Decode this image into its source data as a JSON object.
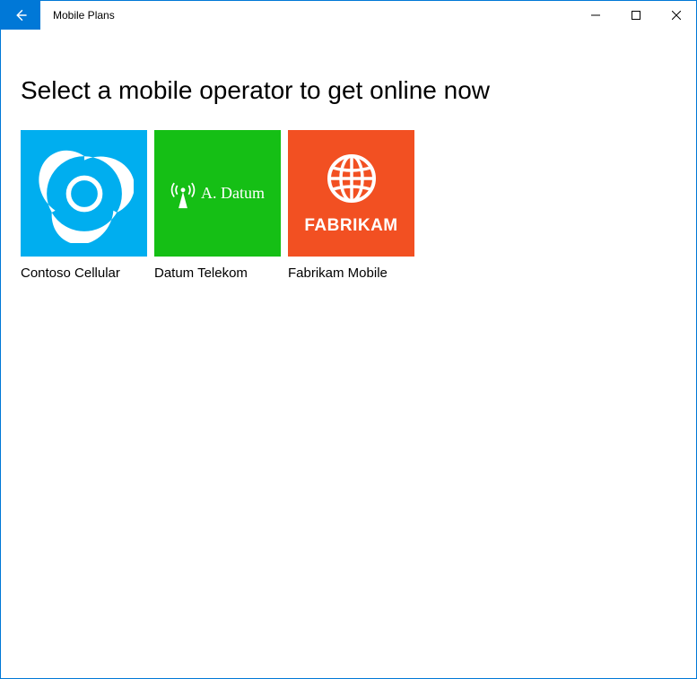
{
  "titlebar": {
    "app_title": "Mobile Plans"
  },
  "content": {
    "heading": "Select a mobile operator to get online now"
  },
  "operators": [
    {
      "id": "contoso",
      "name": "Contoso Cellular",
      "tile_color": "#00AEEF",
      "logo_type": "swirl",
      "logo_text": ""
    },
    {
      "id": "datum",
      "name": "Datum Telekom",
      "tile_color": "#15BF15",
      "logo_type": "antenna",
      "logo_text": "A. Datum"
    },
    {
      "id": "fabrikam",
      "name": "Fabrikam Mobile",
      "tile_color": "#F25022",
      "logo_type": "globe",
      "logo_text": "FABRIKAM"
    }
  ]
}
